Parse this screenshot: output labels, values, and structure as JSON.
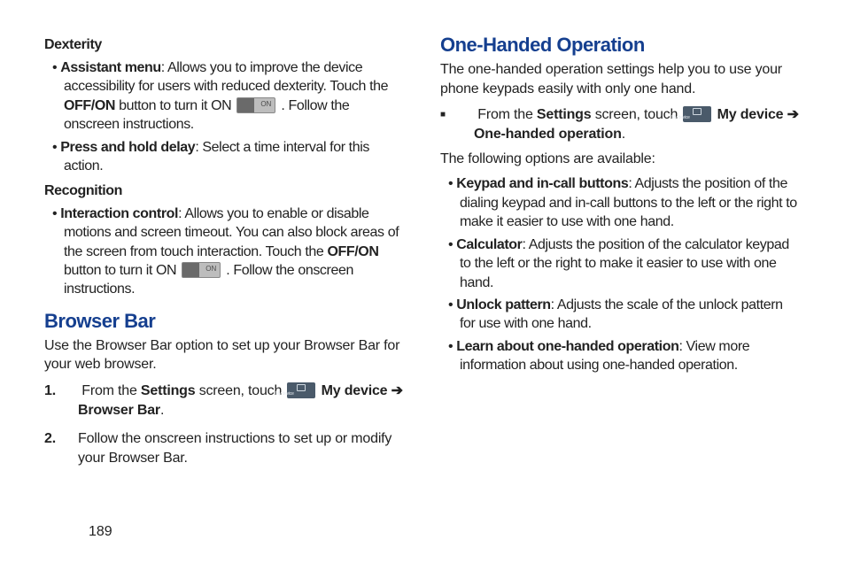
{
  "left": {
    "dexterity_heading": "Dexterity",
    "dex_b1_title": "Assistant menu",
    "dex_b1_body_a": ": Allows you to improve the device accessibility for users with reduced dexterity. Touch the ",
    "dex_b1_off_on": "OFF/ON",
    "dex_b1_body_b": " button to turn it ON ",
    "dex_b1_body_c": " . Follow the onscreen instructions.",
    "dex_b2_title": "Press and hold delay",
    "dex_b2_body": ": Select a time interval for this action.",
    "recognition_heading": "Recognition",
    "rec_b1_title": "Interaction control",
    "rec_b1_body_a": ": Allows you to enable or disable motions and screen timeout. You can also block areas of the screen from touch interaction. Touch the ",
    "rec_b1_off_on": "OFF/ON",
    "rec_b1_body_b": " button to turn it ON ",
    "rec_b1_body_c": " . Follow the onscreen instructions.",
    "browser_heading": "Browser Bar",
    "browser_intro": "Use the Browser Bar option to set up your Browser Bar for your web browser.",
    "step1_a": "From the ",
    "step1_settings": "Settings",
    "step1_b": " screen, touch ",
    "step1_mydevice": "My device",
    "step1_arrow": " ➔ ",
    "step1_browserbar": "Browser Bar",
    "step2": "Follow the onscreen instructions to set up or modify your Browser Bar."
  },
  "right": {
    "onehand_heading": "One-Handed Operation",
    "onehand_intro": "The one-handed operation settings help you to use your phone keypads easily with only one hand.",
    "sq_a": "From the ",
    "sq_settings": "Settings",
    "sq_b": " screen, touch ",
    "sq_mydevice": "My device",
    "sq_arrow": " ➔ ",
    "sq_onehand": "One-handed operation",
    "sq_followup": "The following options are available:",
    "b1_title": "Keypad and in-call buttons",
    "b1_body": ": Adjusts the position of the dialing keypad and in-call buttons to the left or the right to make it easier to use with one hand.",
    "b2_title": "Calculator",
    "b2_body": ": Adjusts the position of the calculator keypad to the left or the right to make it easier to use with one hand.",
    "b3_title": "Unlock pattern",
    "b3_body": ": Adjusts the scale of the unlock pattern for use with one hand.",
    "b4_title": "Learn about one-handed operation",
    "b4_body": ": View more information about using one-handed operation."
  },
  "page_number": "189"
}
